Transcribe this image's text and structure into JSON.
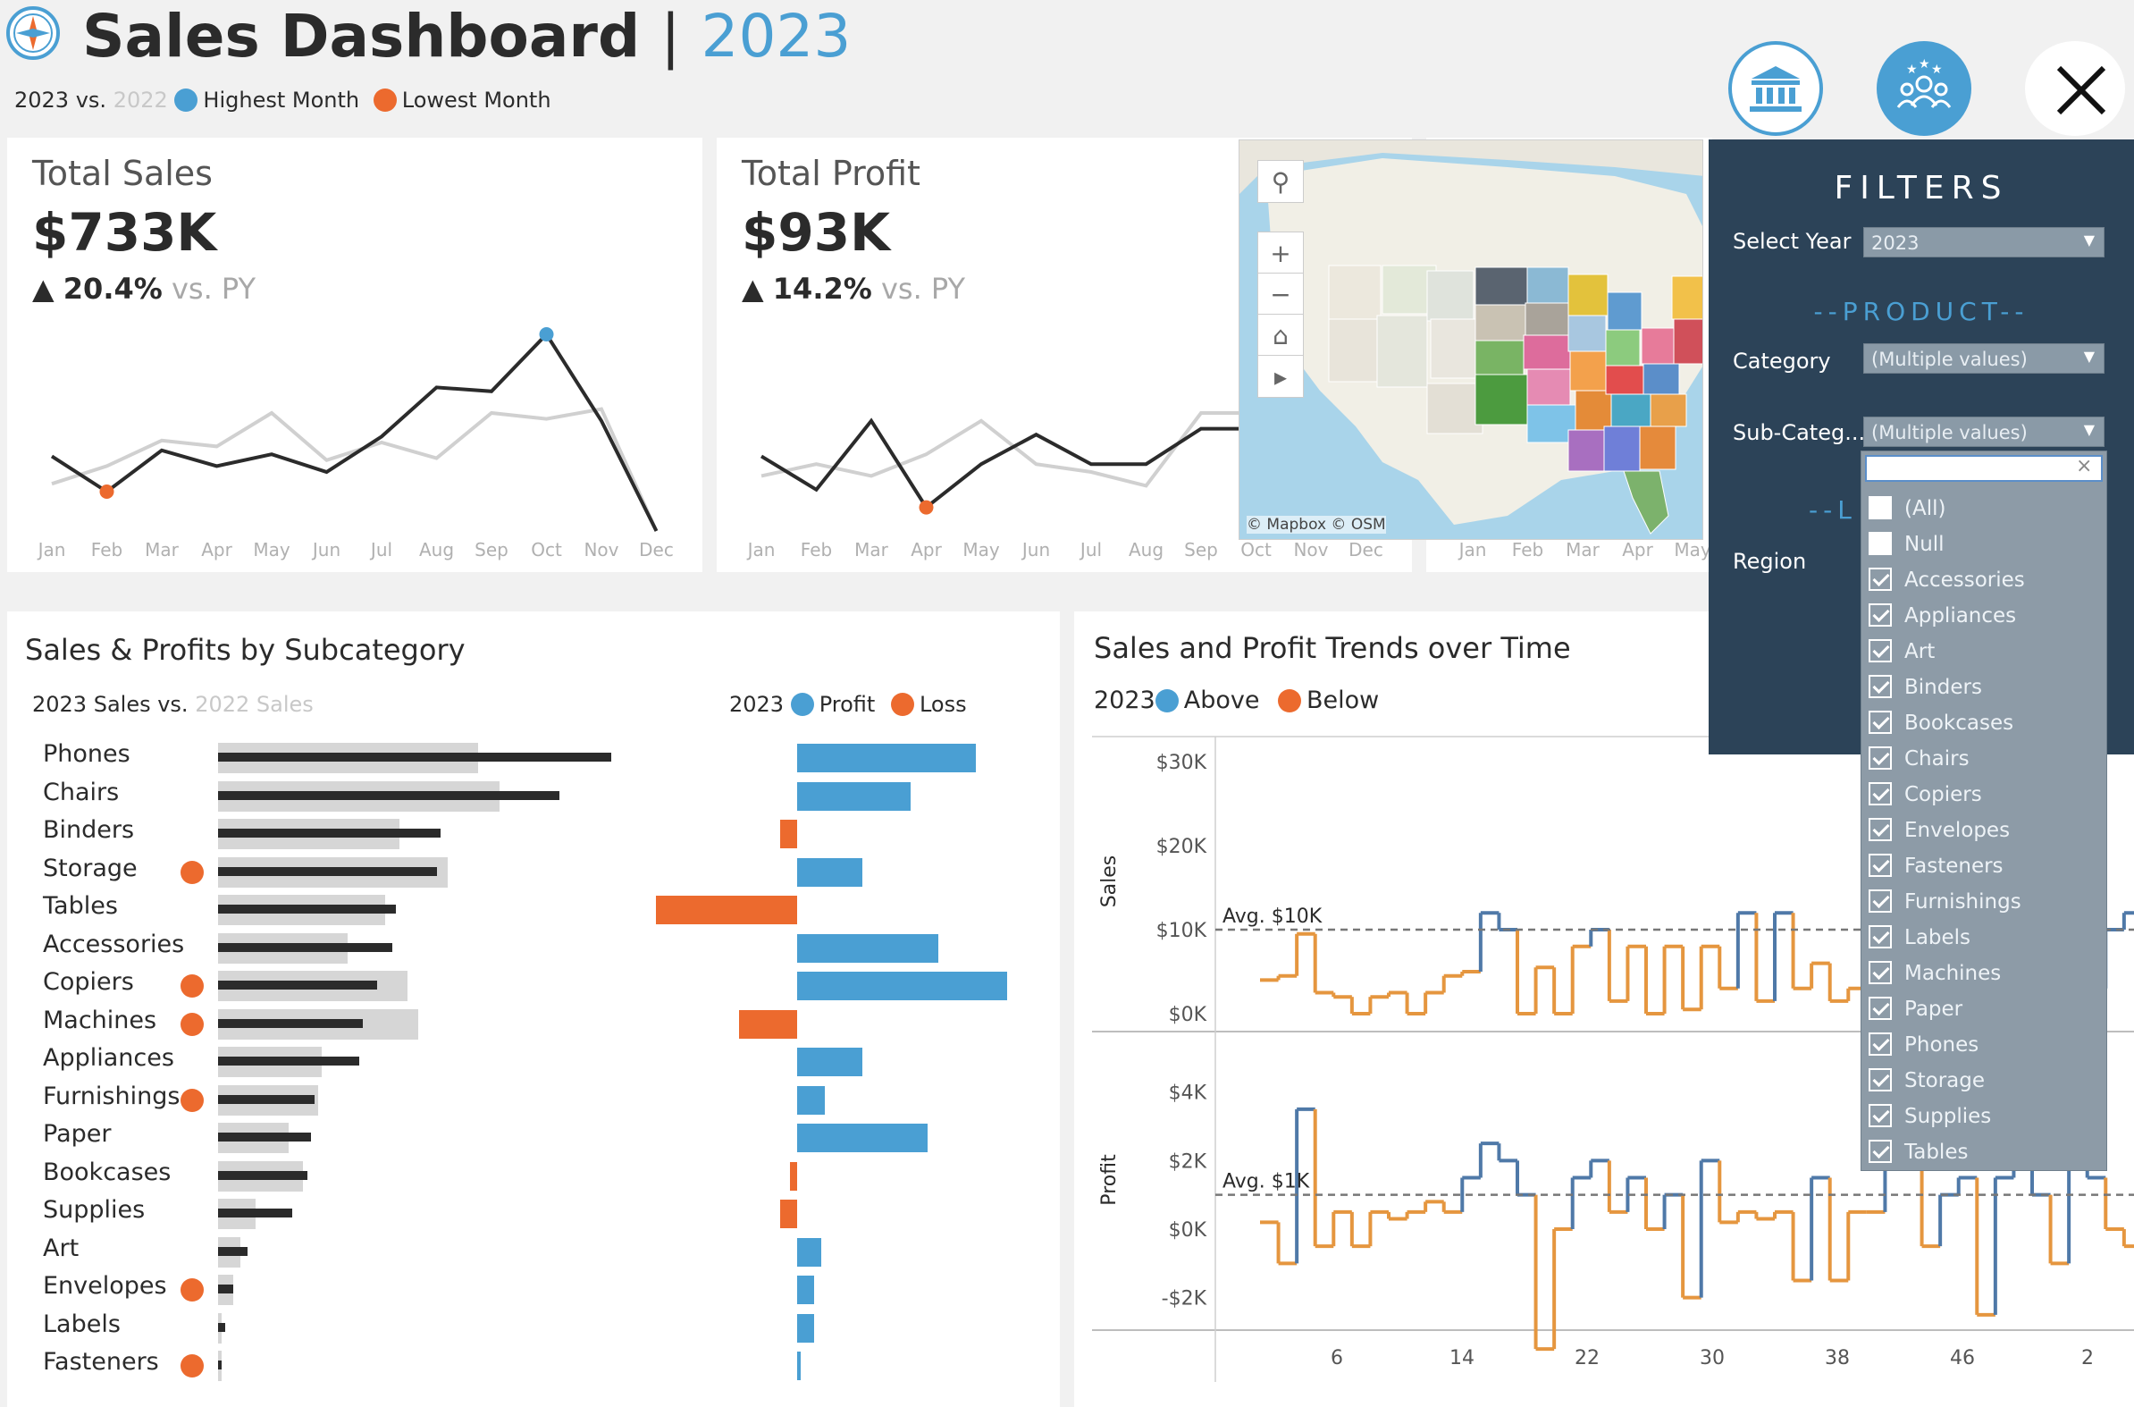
{
  "header": {
    "title": "Sales Dashboard",
    "separator": "|",
    "year": "2023",
    "legend_current": "2023 vs.",
    "legend_prior": "2022",
    "legend_highest": "Highest Month",
    "legend_lowest": "Lowest Month"
  },
  "colors": {
    "blue": "#4a9fd3",
    "orange": "#ec6a2e",
    "dark": "#2b2b2b",
    "grey": "#d4d4d4",
    "navy": "#2c4358"
  },
  "icons": {
    "logo": "compass-icon",
    "bank": "bank-icon",
    "users": "users-icon",
    "close": "close-icon"
  },
  "months": [
    "Jan",
    "Feb",
    "Mar",
    "Apr",
    "May",
    "Jun",
    "Jul",
    "Aug",
    "Sep",
    "Oct",
    "Nov",
    "Dec"
  ],
  "kpis": {
    "sales": {
      "title": "Total Sales",
      "value": "$733K",
      "arrow": "▲",
      "change": "20.4%",
      "vs": "vs. PY",
      "current": [
        38,
        20,
        41,
        33,
        39,
        30,
        48,
        73,
        71,
        100,
        56,
        0
      ],
      "prior": [
        24,
        33,
        46,
        43,
        60,
        36,
        45,
        37,
        60,
        57,
        62,
        0
      ],
      "highest_index": 9,
      "lowest_index": 1
    },
    "profit": {
      "title": "Total Profit",
      "value": "$93K",
      "arrow": "▲",
      "change": "14.2%",
      "vs": "vs. PY",
      "current": [
        38,
        21,
        56,
        12,
        34,
        49,
        34,
        34,
        52,
        52,
        0,
        0
      ],
      "prior": [
        28,
        34,
        28,
        39,
        56,
        34,
        30,
        23,
        60,
        60,
        0,
        0
      ],
      "highest_index": 9,
      "lowest_index": 3
    },
    "third_months": [
      "Jan",
      "Feb",
      "Mar",
      "Apr",
      "May"
    ]
  },
  "map": {
    "attribution": "© Mapbox  © OSM"
  },
  "subcategory": {
    "title": "Sales & Profits by Subcategory",
    "legend_sales_current": "2023 Sales vs.",
    "legend_sales_prior": "2022 Sales",
    "legend_year": "2023",
    "legend_profit": "Profit",
    "legend_loss": "Loss",
    "rows": [
      {
        "name": "Phones",
        "sales_2023": 106,
        "sales_2022": 70,
        "profit": 52,
        "flag": false
      },
      {
        "name": "Chairs",
        "sales_2023": 92,
        "sales_2022": 76,
        "profit": 33,
        "flag": false
      },
      {
        "name": "Binders",
        "sales_2023": 60,
        "sales_2022": 49,
        "profit": -5,
        "flag": false
      },
      {
        "name": "Storage",
        "sales_2023": 59,
        "sales_2022": 62,
        "profit": 19,
        "flag": true
      },
      {
        "name": "Tables",
        "sales_2023": 48,
        "sales_2022": 45,
        "profit": -41,
        "flag": false
      },
      {
        "name": "Accessories",
        "sales_2023": 47,
        "sales_2022": 35,
        "profit": 41,
        "flag": false
      },
      {
        "name": "Copiers",
        "sales_2023": 43,
        "sales_2022": 51,
        "profit": 61,
        "flag": true
      },
      {
        "name": "Machines",
        "sales_2023": 39,
        "sales_2022": 54,
        "profit": -17,
        "flag": true
      },
      {
        "name": "Appliances",
        "sales_2023": 38,
        "sales_2022": 28,
        "profit": 19,
        "flag": false
      },
      {
        "name": "Furnishings",
        "sales_2023": 26,
        "sales_2022": 27,
        "profit": 8,
        "flag": true
      },
      {
        "name": "Paper",
        "sales_2023": 25,
        "sales_2022": 19,
        "profit": 38,
        "flag": false
      },
      {
        "name": "Bookcases",
        "sales_2023": 24,
        "sales_2022": 23,
        "profit": -2,
        "flag": false
      },
      {
        "name": "Supplies",
        "sales_2023": 20,
        "sales_2022": 10,
        "profit": -5,
        "flag": false
      },
      {
        "name": "Art",
        "sales_2023": 8,
        "sales_2022": 6,
        "profit": 7,
        "flag": false
      },
      {
        "name": "Envelopes",
        "sales_2023": 4,
        "sales_2022": 4,
        "profit": 5,
        "flag": true
      },
      {
        "name": "Labels",
        "sales_2023": 2,
        "sales_2022": 1,
        "profit": 5,
        "flag": false
      },
      {
        "name": "Fasteners",
        "sales_2023": 1,
        "sales_2022": 1,
        "profit": 1,
        "flag": true
      }
    ]
  },
  "trends": {
    "title": "Sales and Profit Trends over Time",
    "legend_year": "2023",
    "legend_above": "Above",
    "legend_below": "Below",
    "sales_axis_label": "Sales",
    "profit_axis_label": "Profit",
    "sales_ticks": [
      "$30K",
      "$20K",
      "$10K",
      "$0K"
    ],
    "profit_ticks": [
      "$4K",
      "$2K",
      "$0K",
      "-$2K"
    ],
    "x_ticks": [
      "6",
      "14",
      "22",
      "30",
      "38",
      "46",
      "2"
    ],
    "sales_avg_label": "Avg. $10K",
    "profit_avg_label": "Avg. $1K",
    "sales_avg": 10,
    "profit_avg": 1,
    "sales": [
      4,
      4.5,
      9.5,
      2.5,
      2,
      0,
      2,
      2.5,
      0,
      2.5,
      4.5,
      5,
      12,
      10,
      0,
      5.5,
      0,
      8,
      10,
      1.5,
      8,
      0,
      8,
      0.5,
      8,
      3,
      12,
      1.5,
      12,
      3,
      6,
      1.5,
      3,
      5,
      2,
      12,
      12.5,
      15,
      12,
      13,
      20.5,
      6,
      11,
      6,
      8,
      3,
      10,
      12,
      8
    ],
    "profit": [
      0.2,
      -1,
      3.5,
      -0.5,
      0.5,
      -0.5,
      0.5,
      0.3,
      0.5,
      0.8,
      0.5,
      1.5,
      2.5,
      2,
      1,
      -3.5,
      0,
      1.5,
      2,
      0.5,
      1.5,
      0,
      1,
      -2,
      2,
      0.2,
      0.5,
      0.3,
      0.5,
      -1.5,
      1.5,
      -1.5,
      0.5,
      0.5,
      2.5,
      3,
      -0.5,
      1,
      1.5,
      -2.5,
      1.5,
      2,
      1,
      -1,
      2,
      1.5,
      0,
      -0.5,
      0.5
    ]
  },
  "filters": {
    "title": "FILTERS",
    "product_header": "--PRODUCT--",
    "location_header": "--L",
    "select_year_label": "Select Year",
    "select_year_value": "2023",
    "category_label": "Category",
    "category_value": "(Multiple values)",
    "subcategory_label": "Sub-Categ...",
    "subcategory_value": "(Multiple values)",
    "region_label": "Region",
    "search_placeholder": "",
    "options": [
      {
        "label": "(All)",
        "checked": false
      },
      {
        "label": "Null",
        "checked": false
      },
      {
        "label": "Accessories",
        "checked": true
      },
      {
        "label": "Appliances",
        "checked": true
      },
      {
        "label": "Art",
        "checked": true
      },
      {
        "label": "Binders",
        "checked": true
      },
      {
        "label": "Bookcases",
        "checked": true
      },
      {
        "label": "Chairs",
        "checked": true
      },
      {
        "label": "Copiers",
        "checked": true
      },
      {
        "label": "Envelopes",
        "checked": true
      },
      {
        "label": "Fasteners",
        "checked": true
      },
      {
        "label": "Furnishings",
        "checked": true
      },
      {
        "label": "Labels",
        "checked": true
      },
      {
        "label": "Machines",
        "checked": true
      },
      {
        "label": "Paper",
        "checked": true
      },
      {
        "label": "Phones",
        "checked": true
      },
      {
        "label": "Storage",
        "checked": true
      },
      {
        "label": "Supplies",
        "checked": true
      },
      {
        "label": "Tables",
        "checked": true
      }
    ]
  }
}
